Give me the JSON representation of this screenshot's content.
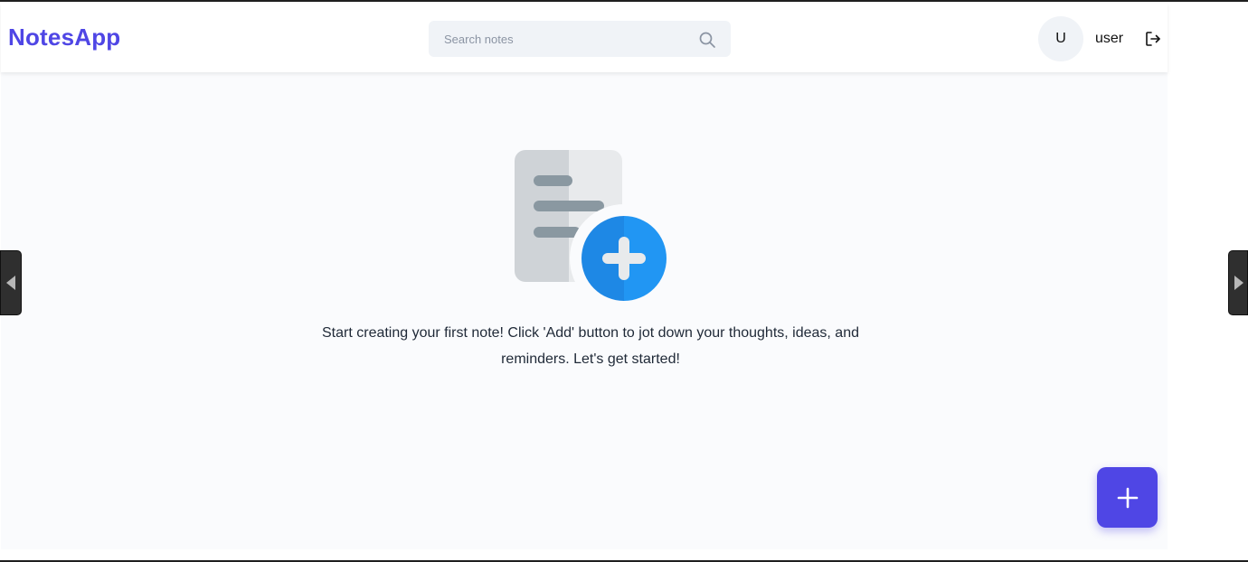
{
  "navbar": {
    "brand": "NotesApp",
    "search": {
      "placeholder": "Search notes",
      "value": "",
      "icon": "search-icon"
    },
    "user": {
      "avatar_initial": "U",
      "name": "user",
      "logout_icon": "logout-icon"
    }
  },
  "main": {
    "empty_state": {
      "illustration": "add-note-illustration",
      "message": "Start creating your first note! Click 'Add' button to jot down your thoughts, ideas, and reminders. Let's get started!"
    }
  },
  "fab": {
    "icon": "plus-icon"
  },
  "side_tabs": {
    "left_icon": "arrow-left-icon",
    "right_icon": "arrow-right-icon"
  },
  "colors": {
    "brand": "#4f46e5",
    "background": "#fafbfd",
    "search_bg": "#f0f3f7",
    "text": "#1f2937",
    "illustration_blue": "#1e88e5",
    "illustration_gray": "#cfd3d7"
  }
}
